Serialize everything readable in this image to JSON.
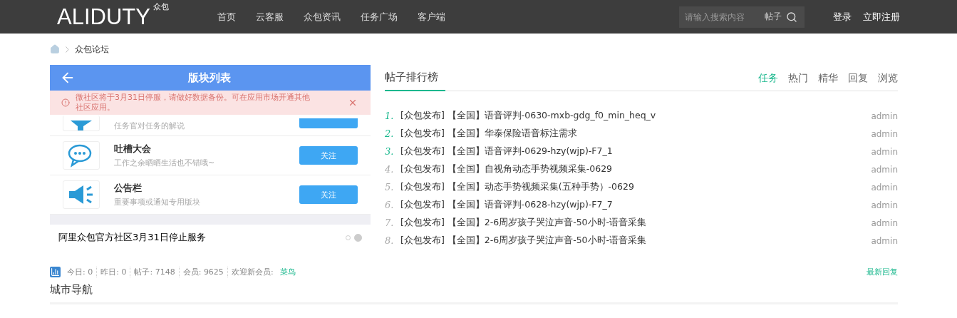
{
  "header": {
    "logo": "ALIDUTY",
    "logo_tag": "众包",
    "nav": [
      {
        "label": "首页",
        "selected": false
      },
      {
        "label": "云客服",
        "selected": false
      },
      {
        "label": "众包资讯",
        "selected": false
      },
      {
        "label": "任务广场",
        "selected": false
      },
      {
        "label": "客户端",
        "selected": false
      }
    ],
    "search": {
      "placeholder": "请输入搜索内容",
      "scope": "帖子"
    },
    "account": [
      "登录",
      "立即注册"
    ]
  },
  "breadcrumb": {
    "current": "众包论坛"
  },
  "slide": {
    "app_title": "版块列表",
    "notice": "微社区将于3月31日停服，请做好数据备份。可在应用市场开通其他社区应用。",
    "boards": [
      {
        "kind": "partial",
        "desc": "任务官对任务的解说"
      },
      {
        "kind": "chat",
        "name": "吐槽大会",
        "desc": "工作之余晒晒生活也不错哦~",
        "action": "关注"
      },
      {
        "kind": "speaker",
        "name": "公告栏",
        "desc": "重要事项或通知专用版块",
        "action": "关注"
      }
    ],
    "caption": "阿里众包官方社区3月31日停止服务",
    "dots": [
      {
        "selected": false
      },
      {
        "selected": true
      }
    ]
  },
  "ranking": {
    "title": "帖子排行榜",
    "tabs": [
      {
        "label": "任务",
        "selected": true
      },
      {
        "label": "热门",
        "selected": false
      },
      {
        "label": "精华",
        "selected": false
      },
      {
        "label": "回复",
        "selected": false
      },
      {
        "label": "浏览",
        "selected": false
      }
    ],
    "posts": [
      {
        "rank": "1.",
        "highlighted": true,
        "title": "[众包发布] 【全国】语音评判-0630-mxb-gdg_f0_min_heq_v",
        "author": "admin"
      },
      {
        "rank": "2.",
        "highlighted": true,
        "title": "[众包发布] 【全国】华泰保险语音标注需求",
        "author": "admin"
      },
      {
        "rank": "3.",
        "highlighted": true,
        "title": "[众包发布] 【全国】语音评判-0629-hzy(wjp)-F7_1",
        "author": "admin"
      },
      {
        "rank": "4.",
        "highlighted": false,
        "title": "[众包发布] 【全国】自视角动态手势视频采集-0629",
        "author": "admin"
      },
      {
        "rank": "5.",
        "highlighted": false,
        "title": "[众包发布] 【全国】动态手势视频采集(五种手势）-0629",
        "author": "admin"
      },
      {
        "rank": "6.",
        "highlighted": false,
        "title": "[众包发布] 【全国】语音评判-0628-hzy(wjp)-F7_7",
        "author": "admin"
      },
      {
        "rank": "7.",
        "highlighted": false,
        "title": "[众包发布] 【全国】2-6周岁孩子哭泣声音-50小时-语音采集",
        "author": "admin"
      },
      {
        "rank": "8.",
        "highlighted": false,
        "title": "[众包发布] 【全国】2-6周岁孩子哭泣声音-50小时-语音采集",
        "author": "admin"
      }
    ]
  },
  "stats": {
    "items": [
      {
        "label": "今日:",
        "value": "0"
      },
      {
        "label": "昨日:",
        "value": "0"
      },
      {
        "label": "帖子:",
        "value": "7148"
      },
      {
        "label": "会员:",
        "value": "9625"
      }
    ],
    "new_member_label": "欢迎新会员:",
    "new_member": "菜鸟",
    "latest_link": "最新回复"
  },
  "city_nav": {
    "title": "城市导航"
  }
}
